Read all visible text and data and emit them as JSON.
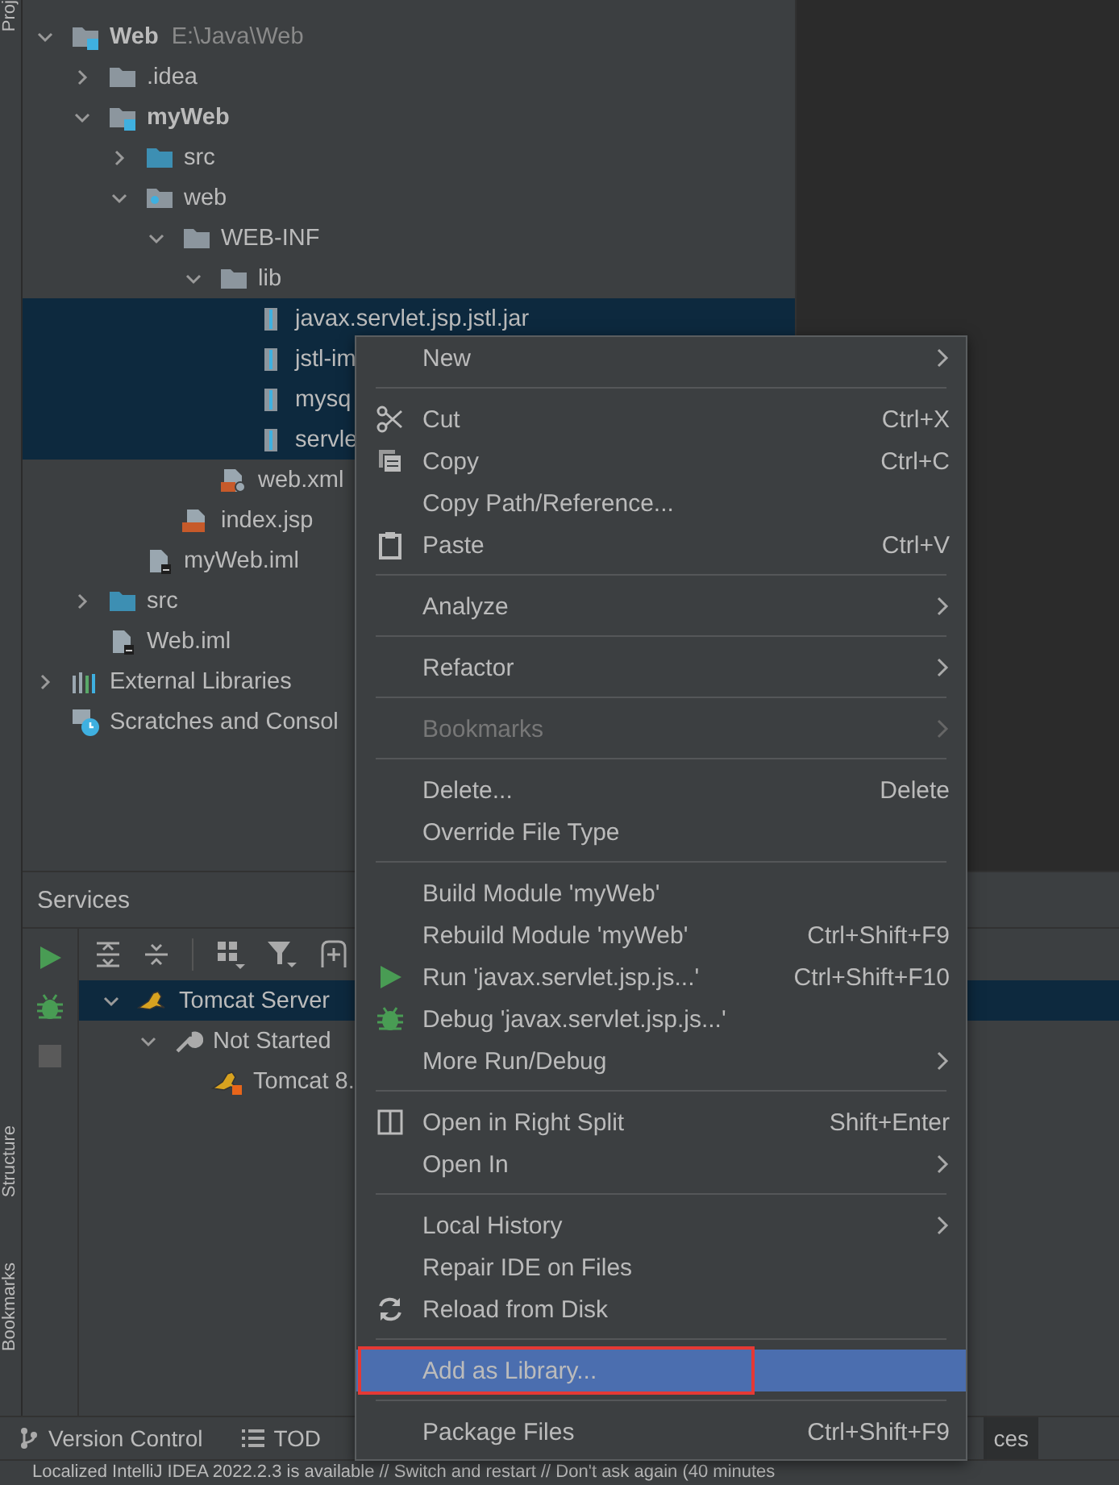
{
  "left_strip": {
    "top_tabs": [
      "Proj"
    ],
    "bottom_tabs": [
      "Structure",
      "Bookmarks"
    ]
  },
  "project": {
    "tree": [
      {
        "label": "Web",
        "hint": "E:\\Java\\Web",
        "kind": "module",
        "expanded": true,
        "selected": false,
        "children": [
          {
            "label": ".idea",
            "kind": "folder",
            "expanded": false,
            "selected": false
          },
          {
            "label": "myWeb",
            "kind": "module",
            "expanded": true,
            "selected": false,
            "children": [
              {
                "label": "src",
                "kind": "source-folder",
                "expanded": false,
                "selected": false
              },
              {
                "label": "web",
                "kind": "web-folder",
                "expanded": true,
                "selected": false,
                "children": [
                  {
                    "label": "WEB-INF",
                    "kind": "folder",
                    "expanded": true,
                    "selected": false,
                    "children": [
                      {
                        "label": "lib",
                        "kind": "folder",
                        "expanded": true,
                        "selected": false,
                        "children": [
                          {
                            "label": "javax.servlet.jsp.jstl.jar",
                            "kind": "jar",
                            "selected": true
                          },
                          {
                            "label": "jstl-im",
                            "kind": "jar",
                            "selected": true
                          },
                          {
                            "label": "mysq",
                            "kind": "jar",
                            "selected": true
                          },
                          {
                            "label": "servle",
                            "kind": "jar",
                            "selected": true
                          }
                        ]
                      },
                      {
                        "label": "web.xml",
                        "kind": "xml",
                        "selected": false
                      }
                    ]
                  },
                  {
                    "label": "index.jsp",
                    "kind": "jsp",
                    "selected": false
                  }
                ]
              },
              {
                "label": "myWeb.iml",
                "kind": "iml",
                "selected": false
              }
            ]
          },
          {
            "label": "src",
            "kind": "source-folder",
            "expanded": false,
            "selected": false
          },
          {
            "label": "Web.iml",
            "kind": "iml",
            "selected": false
          }
        ]
      },
      {
        "label": "External Libraries",
        "kind": "libraries",
        "expanded": false,
        "selected": false
      },
      {
        "label": "Scratches and Consol",
        "kind": "scratches",
        "selected": false
      }
    ]
  },
  "services": {
    "title": "Services",
    "tree": [
      {
        "label": "Tomcat Server",
        "kind": "tomcat",
        "expanded": true,
        "selected": true,
        "children": [
          {
            "label": "Not Started",
            "kind": "wrench",
            "expanded": true,
            "selected": false,
            "children": [
              {
                "label": "Tomcat 8.",
                "kind": "tomcat-stopped",
                "selected": false
              }
            ]
          }
        ]
      }
    ]
  },
  "context_menu": {
    "items": [
      {
        "kind": "item",
        "label": "New",
        "submenu": true,
        "selected": false,
        "disabled": false,
        "annotated": false
      },
      {
        "kind": "separator"
      },
      {
        "kind": "item",
        "label": "Cut",
        "shortcut": "Ctrl+X",
        "selected": false,
        "disabled": false,
        "annotated": false
      },
      {
        "kind": "item",
        "label": "Copy",
        "shortcut": "Ctrl+C",
        "selected": false,
        "disabled": false,
        "annotated": false
      },
      {
        "kind": "item",
        "label": "Copy Path/Reference...",
        "selected": false,
        "disabled": false,
        "annotated": false
      },
      {
        "kind": "item",
        "label": "Paste",
        "shortcut": "Ctrl+V",
        "selected": false,
        "disabled": false,
        "annotated": false
      },
      {
        "kind": "separator"
      },
      {
        "kind": "item",
        "label": "Analyze",
        "submenu": true,
        "selected": false,
        "disabled": false,
        "annotated": false
      },
      {
        "kind": "separator"
      },
      {
        "kind": "item",
        "label": "Refactor",
        "submenu": true,
        "selected": false,
        "disabled": false,
        "annotated": false
      },
      {
        "kind": "separator"
      },
      {
        "kind": "item",
        "label": "Bookmarks",
        "submenu": true,
        "selected": false,
        "disabled": true,
        "annotated": false
      },
      {
        "kind": "separator"
      },
      {
        "kind": "item",
        "label": "Delete...",
        "shortcut": "Delete",
        "selected": false,
        "disabled": false,
        "annotated": false
      },
      {
        "kind": "item",
        "label": "Override File Type",
        "selected": false,
        "disabled": false,
        "annotated": false
      },
      {
        "kind": "separator"
      },
      {
        "kind": "item",
        "label": "Build Module 'myWeb'",
        "selected": false,
        "disabled": false,
        "annotated": false
      },
      {
        "kind": "item",
        "label": "Rebuild Module 'myWeb'",
        "shortcut": "Ctrl+Shift+F9",
        "selected": false,
        "disabled": false,
        "annotated": false
      },
      {
        "kind": "item",
        "label": "Run 'javax.servlet.jsp.js...'",
        "shortcut": "Ctrl+Shift+F10",
        "selected": false,
        "disabled": false,
        "annotated": false
      },
      {
        "kind": "item",
        "label": "Debug 'javax.servlet.jsp.js...'",
        "selected": false,
        "disabled": false,
        "annotated": false
      },
      {
        "kind": "item",
        "label": "More Run/Debug",
        "submenu": true,
        "selected": false,
        "disabled": false,
        "annotated": false
      },
      {
        "kind": "separator"
      },
      {
        "kind": "item",
        "label": "Open in Right Split",
        "shortcut": "Shift+Enter",
        "selected": false,
        "disabled": false,
        "annotated": false
      },
      {
        "kind": "item",
        "label": "Open In",
        "submenu": true,
        "selected": false,
        "disabled": false,
        "annotated": false
      },
      {
        "kind": "separator"
      },
      {
        "kind": "item",
        "label": "Local History",
        "submenu": true,
        "selected": false,
        "disabled": false,
        "annotated": false
      },
      {
        "kind": "item",
        "label": "Repair IDE on Files",
        "selected": false,
        "disabled": false,
        "annotated": false
      },
      {
        "kind": "item",
        "label": "Reload from Disk",
        "selected": false,
        "disabled": false,
        "annotated": false
      },
      {
        "kind": "separator"
      },
      {
        "kind": "item",
        "label": "Add as Library...",
        "selected": true,
        "disabled": false,
        "annotated": true
      },
      {
        "kind": "separator"
      },
      {
        "kind": "item",
        "label": "Package Files",
        "shortcut": "Ctrl+Shift+F9",
        "selected": false,
        "disabled": false,
        "annotated": false
      }
    ]
  },
  "tool_tabs": [
    {
      "label": "Version Control",
      "kind": "vcs",
      "selected": false
    },
    {
      "label": "TOD",
      "kind": "todo",
      "selected": false
    },
    {
      "label": "ces",
      "kind": "plain",
      "selected": true
    }
  ],
  "status_bar": {
    "text": "Localized IntelliJ IDEA 2022.2.3 is available // Switch and restart // Don't ask again (40 minutes"
  }
}
